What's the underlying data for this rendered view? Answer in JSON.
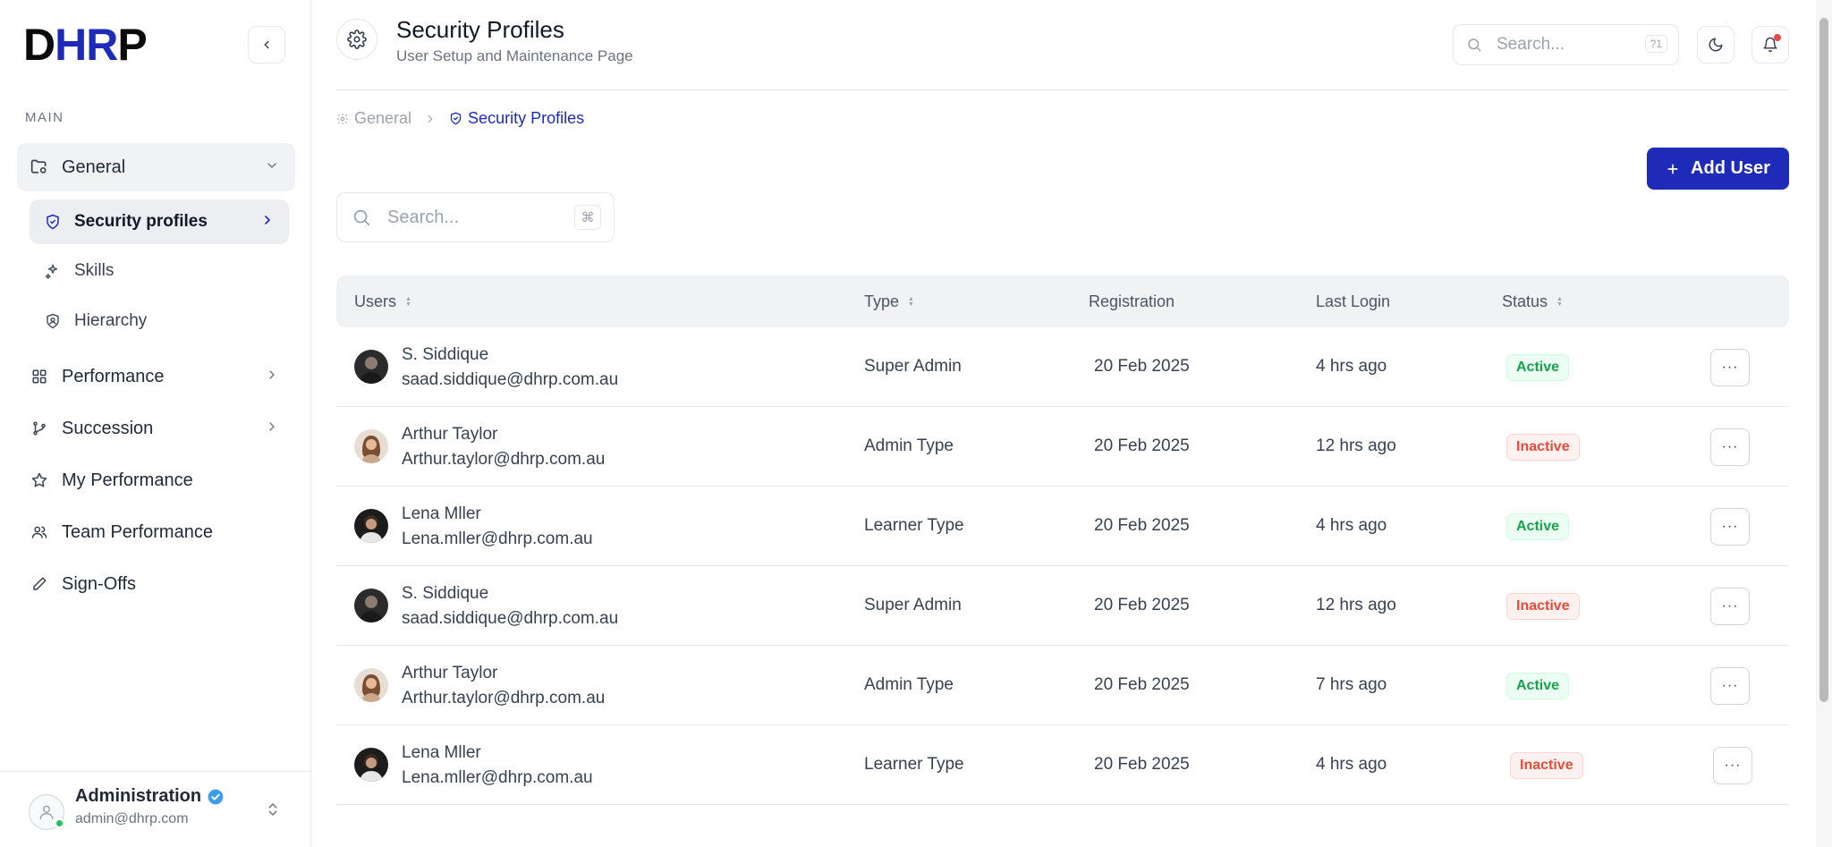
{
  "sidebar": {
    "logo": {
      "part1": "D",
      "part2": "HR",
      "part3": "P"
    },
    "section_label": "MAIN",
    "nav": {
      "general": "General",
      "security_profiles": "Security profiles",
      "skills": "Skills",
      "hierarchy": "Hierarchy",
      "performance": "Performance",
      "succession": "Succession",
      "my_performance": "My Performance",
      "team_performance": "Team Performance",
      "sign_offs": "Sign-Offs"
    },
    "footer": {
      "name": "Administration",
      "email": "admin@dhrp.com"
    }
  },
  "header": {
    "title": "Security Profiles",
    "subtitle": "User Setup and Maintenance Page",
    "search_placeholder": "Search...",
    "search_shortcut": "?1"
  },
  "breadcrumb": {
    "parent": "General",
    "current": "Security Profiles"
  },
  "toolbar": {
    "add_user_label": "Add User",
    "search_placeholder": "Search...",
    "search_shortcut": "⌘"
  },
  "table": {
    "columns": {
      "users": "Users",
      "type": "Type",
      "registration": "Registration",
      "last_login": "Last Login",
      "status": "Status"
    },
    "rows": [
      {
        "name": "S. Siddique",
        "email": "saad.siddique@dhrp.com.au",
        "type": "Super Admin",
        "registration": "20 Feb 2025",
        "last_login": "4 hrs ago",
        "status": "Active"
      },
      {
        "name": "Arthur Taylor",
        "email": "Arthur.taylor@dhrp.com.au",
        "type": "Admin Type",
        "registration": "20 Feb 2025",
        "last_login": "12 hrs ago",
        "status": "Inactive"
      },
      {
        "name": "Lena Mller",
        "email": "Lena.mller@dhrp.com.au",
        "type": "Learner Type",
        "registration": "20 Feb 2025",
        "last_login": "4 hrs ago",
        "status": "Active"
      },
      {
        "name": "S. Siddique",
        "email": "saad.siddique@dhrp.com.au",
        "type": "Super Admin",
        "registration": "20 Feb 2025",
        "last_login": "12 hrs ago",
        "status": "Inactive"
      },
      {
        "name": "Arthur Taylor",
        "email": "Arthur.taylor@dhrp.com.au",
        "type": "Admin Type",
        "registration": "20 Feb 2025",
        "last_login": "7 hrs ago",
        "status": "Active"
      },
      {
        "name": "Lena Mller",
        "email": "Lena.mller@dhrp.com.au",
        "type": "Learner Type",
        "registration": "20 Feb 2025",
        "last_login": "4 hrs ago",
        "status": "Inactive"
      }
    ],
    "row_action_label": "···"
  },
  "colors": {
    "brand": "#1e2bb8",
    "active": "#16a34a",
    "inactive": "#e34b3a",
    "notification": "#ef4444",
    "online": "#22c55e"
  }
}
